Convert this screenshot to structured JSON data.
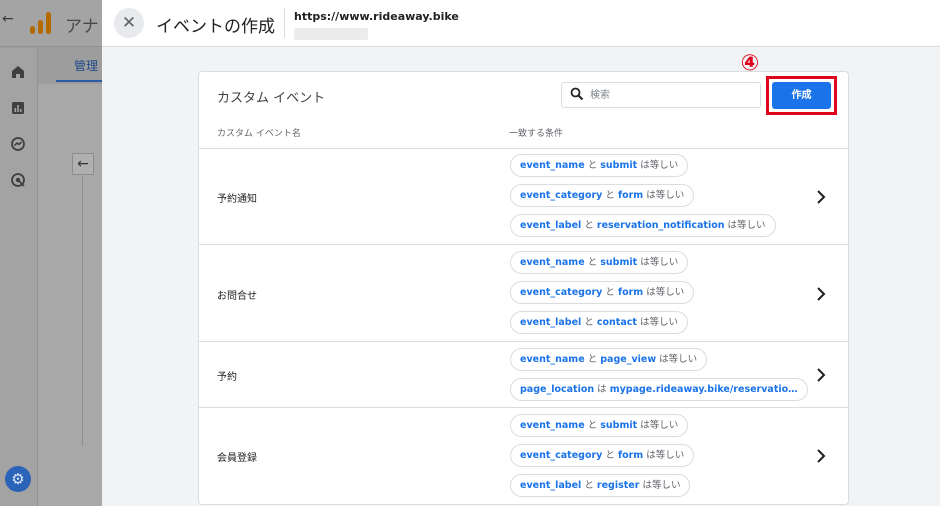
{
  "background_app": {
    "title": "アナ",
    "tab": "管理",
    "back_icon": "arrow-left-icon",
    "nav_icons": [
      "home-icon",
      "reports-icon",
      "explore-icon",
      "advertising-icon"
    ],
    "settings_icon": "gear-icon"
  },
  "panel": {
    "title": "イベントの作成",
    "site_url": "https://www.rideaway.bike",
    "close_icon": "close-icon"
  },
  "card": {
    "title": "カスタム イベント",
    "search_placeholder": "検索",
    "create_label": "作成",
    "step_marker": "④",
    "columns": {
      "name": "カスタム イベント名",
      "conditions": "一致する条件"
    },
    "events": [
      {
        "name": "予約通知",
        "conditions": [
          {
            "param": "event_name",
            "connector": "と",
            "value": "submit",
            "op": "は等しい"
          },
          {
            "param": "event_category",
            "connector": "と",
            "value": "form",
            "op": "は等しい"
          },
          {
            "param": "event_label",
            "connector": "と",
            "value": "reservation_notification",
            "op": "は等しい"
          }
        ]
      },
      {
        "name": "お問合せ",
        "conditions": [
          {
            "param": "event_name",
            "connector": "と",
            "value": "submit",
            "op": "は等しい"
          },
          {
            "param": "event_category",
            "connector": "と",
            "value": "form",
            "op": "は等しい"
          },
          {
            "param": "event_label",
            "connector": "と",
            "value": "contact",
            "op": "は等しい"
          }
        ]
      },
      {
        "name": "予約",
        "conditions": [
          {
            "param": "event_name",
            "connector": "と",
            "value": "page_view",
            "op": "は等しい"
          },
          {
            "param": "page_location",
            "connector": "は",
            "value": "mypage.rideaway.bike/reservatio…",
            "op": ""
          }
        ]
      },
      {
        "name": "会員登録",
        "conditions": [
          {
            "param": "event_name",
            "connector": "と",
            "value": "submit",
            "op": "は等しい"
          },
          {
            "param": "event_category",
            "connector": "と",
            "value": "form",
            "op": "は等しい"
          },
          {
            "param": "event_label",
            "connector": "と",
            "value": "register",
            "op": "は等しい"
          }
        ]
      }
    ]
  },
  "colors": {
    "accent": "#1a73e8",
    "highlight": "#e0051c",
    "logo": "#f9ab00"
  }
}
